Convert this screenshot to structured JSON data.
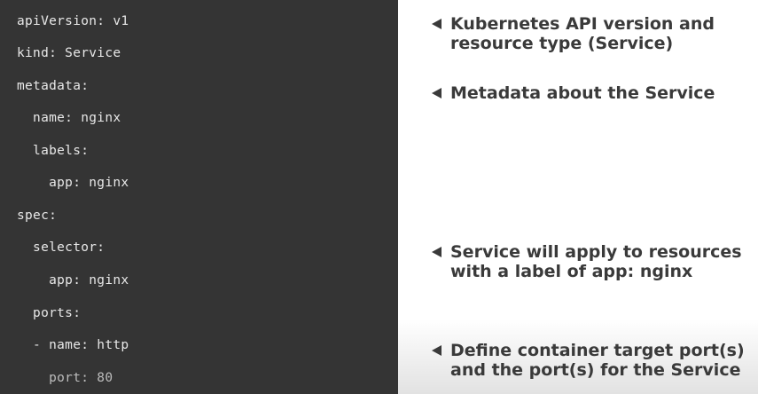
{
  "code": {
    "lines": [
      "apiVersion: v1",
      "kind: Service",
      "metadata:",
      "  name: nginx",
      "  labels:",
      "    app: nginx",
      "spec:",
      "  selector:",
      "    app: nginx",
      "  ports:",
      "  - name: http",
      "    port: 80"
    ]
  },
  "notes": [
    {
      "arrow_icon": "left-triangle-icon",
      "text": "Kubernetes API version and\nresource type (Service)"
    },
    {
      "arrow_icon": "left-triangle-icon",
      "text": "Metadata about the Service"
    },
    {
      "arrow_icon": "left-triangle-icon",
      "text": "Service will apply to resources\nwith a label of app: nginx"
    },
    {
      "arrow_icon": "left-triangle-icon",
      "text": "Define container target port(s)\nand the port(s) for the Service"
    }
  ],
  "colors": {
    "code_background": "#343434",
    "code_text": "#e8e8e8",
    "note_text": "#3a3a3a"
  }
}
